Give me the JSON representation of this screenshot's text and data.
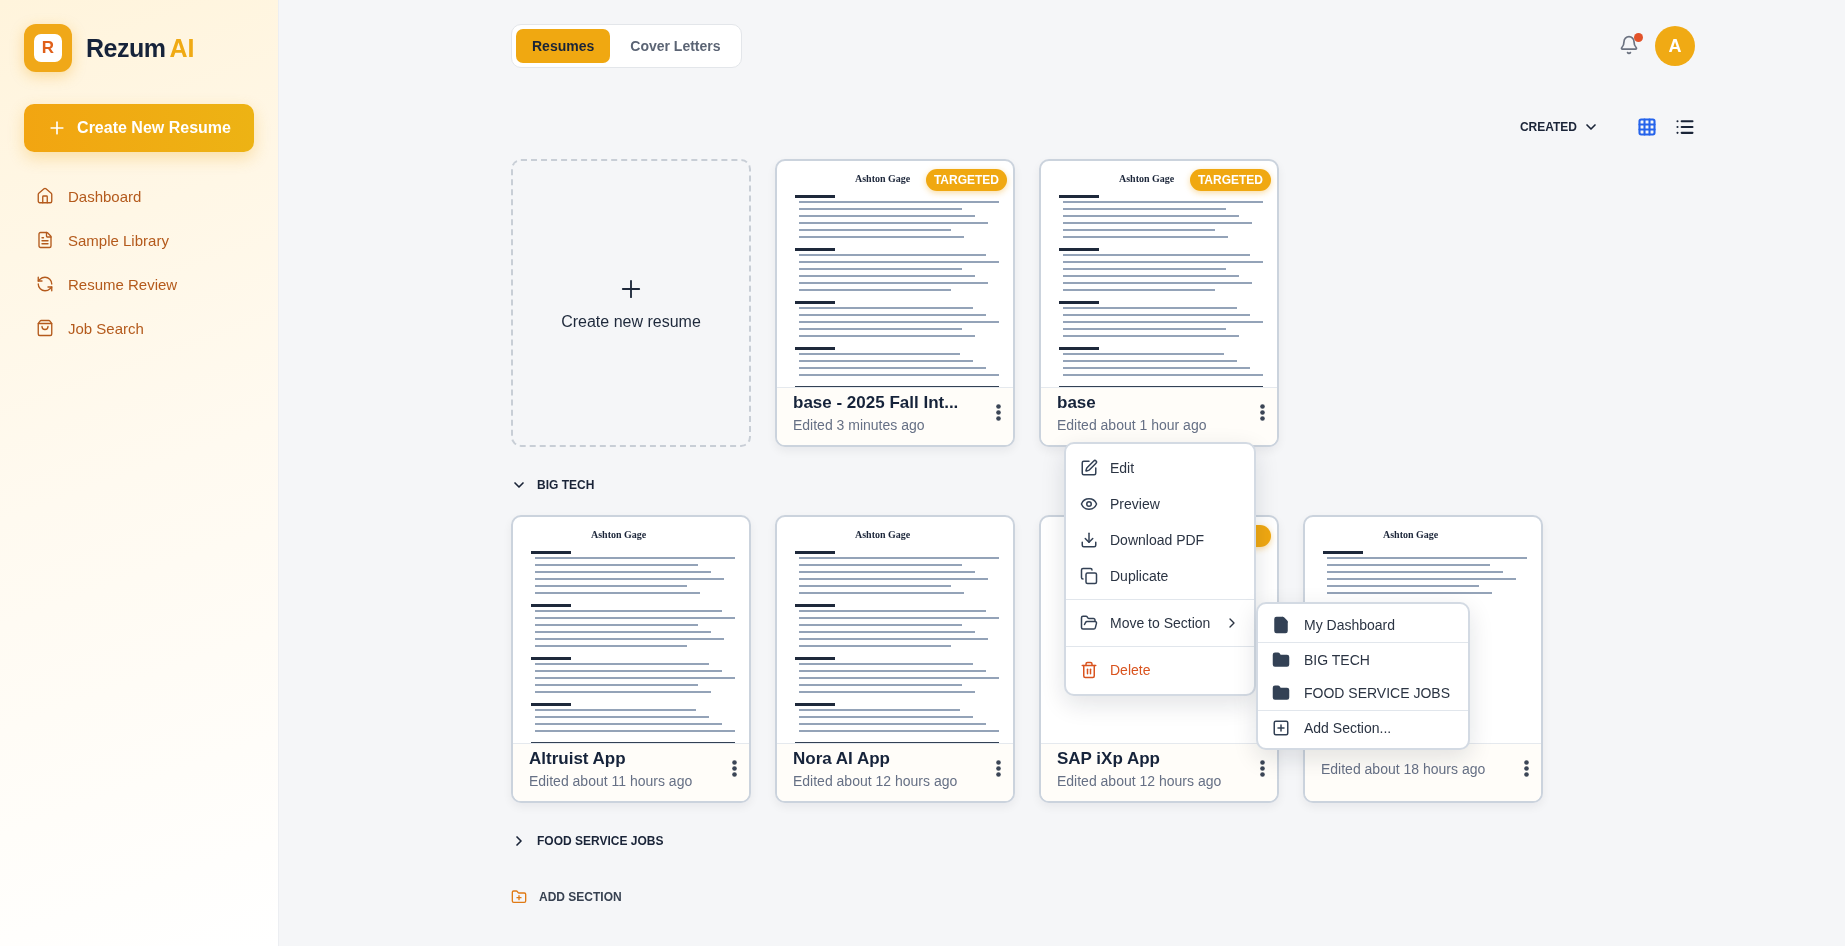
{
  "brand": {
    "mark": "R",
    "name": "Rezum",
    "suffix": "AI"
  },
  "create_button": "Create New Resume",
  "nav": [
    {
      "kind": "home",
      "label": "Dashboard"
    },
    {
      "kind": "document",
      "label": "Sample Library"
    },
    {
      "kind": "refresh",
      "label": "Resume Review"
    },
    {
      "kind": "bag",
      "label": "Job Search"
    }
  ],
  "tabs": [
    {
      "label": "Resumes",
      "selected": true
    },
    {
      "label": "Cover Letters",
      "selected": false
    }
  ],
  "notifications": {
    "unread": true
  },
  "avatar": "A",
  "sort": {
    "label": "CREATED"
  },
  "view_modes": [
    {
      "kind": "grid",
      "selected": true
    },
    {
      "kind": "list",
      "selected": false
    }
  ],
  "create_card": "Create new resume",
  "resumes": [
    {
      "title": "base - 2025 Fall Int...",
      "edited": "Edited 3 minutes ago",
      "targeted": true,
      "badge": "TARGETED",
      "thumbnail_name": "Ashton Gage"
    },
    {
      "title": "base",
      "edited": "Edited about 1 hour ago",
      "targeted": true,
      "badge": "TARGETED",
      "thumbnail_name": "Ashton Gage",
      "menu_open": true
    }
  ],
  "sections": [
    {
      "title": "BIG TECH",
      "expanded": true,
      "resumes": [
        {
          "title": "Altruist App",
          "edited": "Edited about 11 hours ago",
          "targeted": false,
          "thumbnail_name": "Ashton Gage"
        },
        {
          "title": "Nora AI App",
          "edited": "Edited about 12 hours ago",
          "targeted": false,
          "thumbnail_name": "Ashton Gage"
        },
        {
          "title": "SAP iXp App",
          "edited": "Edited about 12 hours ago",
          "targeted": true
        },
        {
          "edited": "Edited about 18 hours ago",
          "targeted": false,
          "thumbnail_name": "Ashton Gage"
        }
      ]
    },
    {
      "title": "FOOD SERVICE JOBS",
      "expanded": false
    }
  ],
  "add_section": "ADD SECTION",
  "context_menu": {
    "items": [
      {
        "kind": "edit",
        "label": "Edit"
      },
      {
        "kind": "preview",
        "label": "Preview"
      },
      {
        "kind": "download",
        "label": "Download PDF"
      },
      {
        "kind": "duplicate",
        "label": "Duplicate"
      },
      {
        "kind": "move",
        "label": "Move to Section",
        "expanded": true
      },
      {
        "kind": "delete",
        "label": "Delete"
      }
    ]
  },
  "submenu": {
    "items": [
      {
        "kind": "dashboard",
        "label": "My Dashboard"
      },
      {
        "kind": "folder",
        "label": "BIG TECH"
      },
      {
        "kind": "folder",
        "label": "FOOD SERVICE JOBS"
      },
      {
        "kind": "add",
        "label": "Add Section..."
      }
    ]
  }
}
